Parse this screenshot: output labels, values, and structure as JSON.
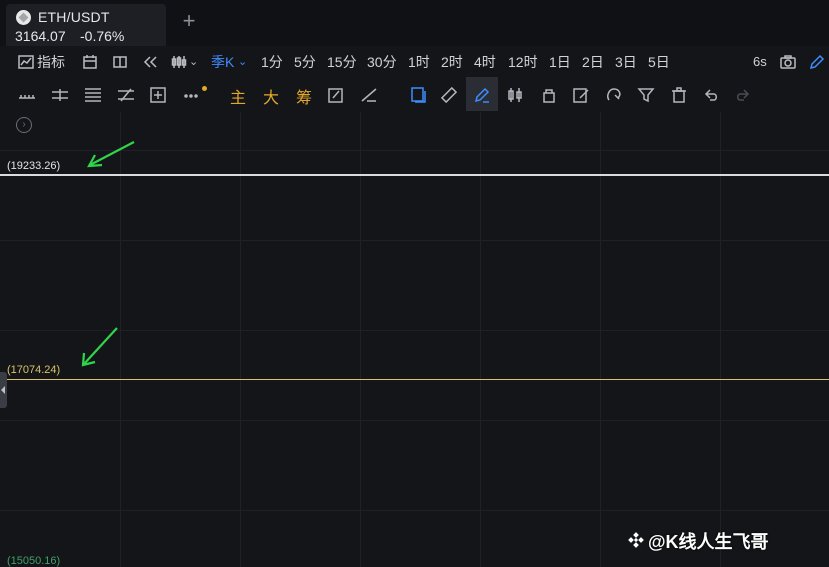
{
  "tab": {
    "pair": "ETH/USDT",
    "price": "3164.07",
    "change": "-0.76%",
    "coin_icon": "binance-coin-icon"
  },
  "toolbar": {
    "indicator_label": "指标",
    "active_interval": "季K",
    "intervals": [
      "1分",
      "5分",
      "15分",
      "30分",
      "1时",
      "2时",
      "4时",
      "12时",
      "1日",
      "2日",
      "3日",
      "5日"
    ],
    "refresh": "6s",
    "accent_color": "#3e8dff"
  },
  "drawing_toolbar": {
    "text_tools": [
      "主",
      "大",
      "筹"
    ],
    "text_color": "#e3a82a"
  },
  "chart": {
    "levels": [
      {
        "label": "(19233.26)",
        "color": "#d9dbe0"
      },
      {
        "label": "(17074.24)",
        "color": "#d8c36a"
      },
      {
        "label": "(15050.16)",
        "color": "#3fa06a"
      }
    ],
    "arrow_color": "#2fd54a"
  },
  "watermark": {
    "text": "@K线人生飞哥"
  }
}
